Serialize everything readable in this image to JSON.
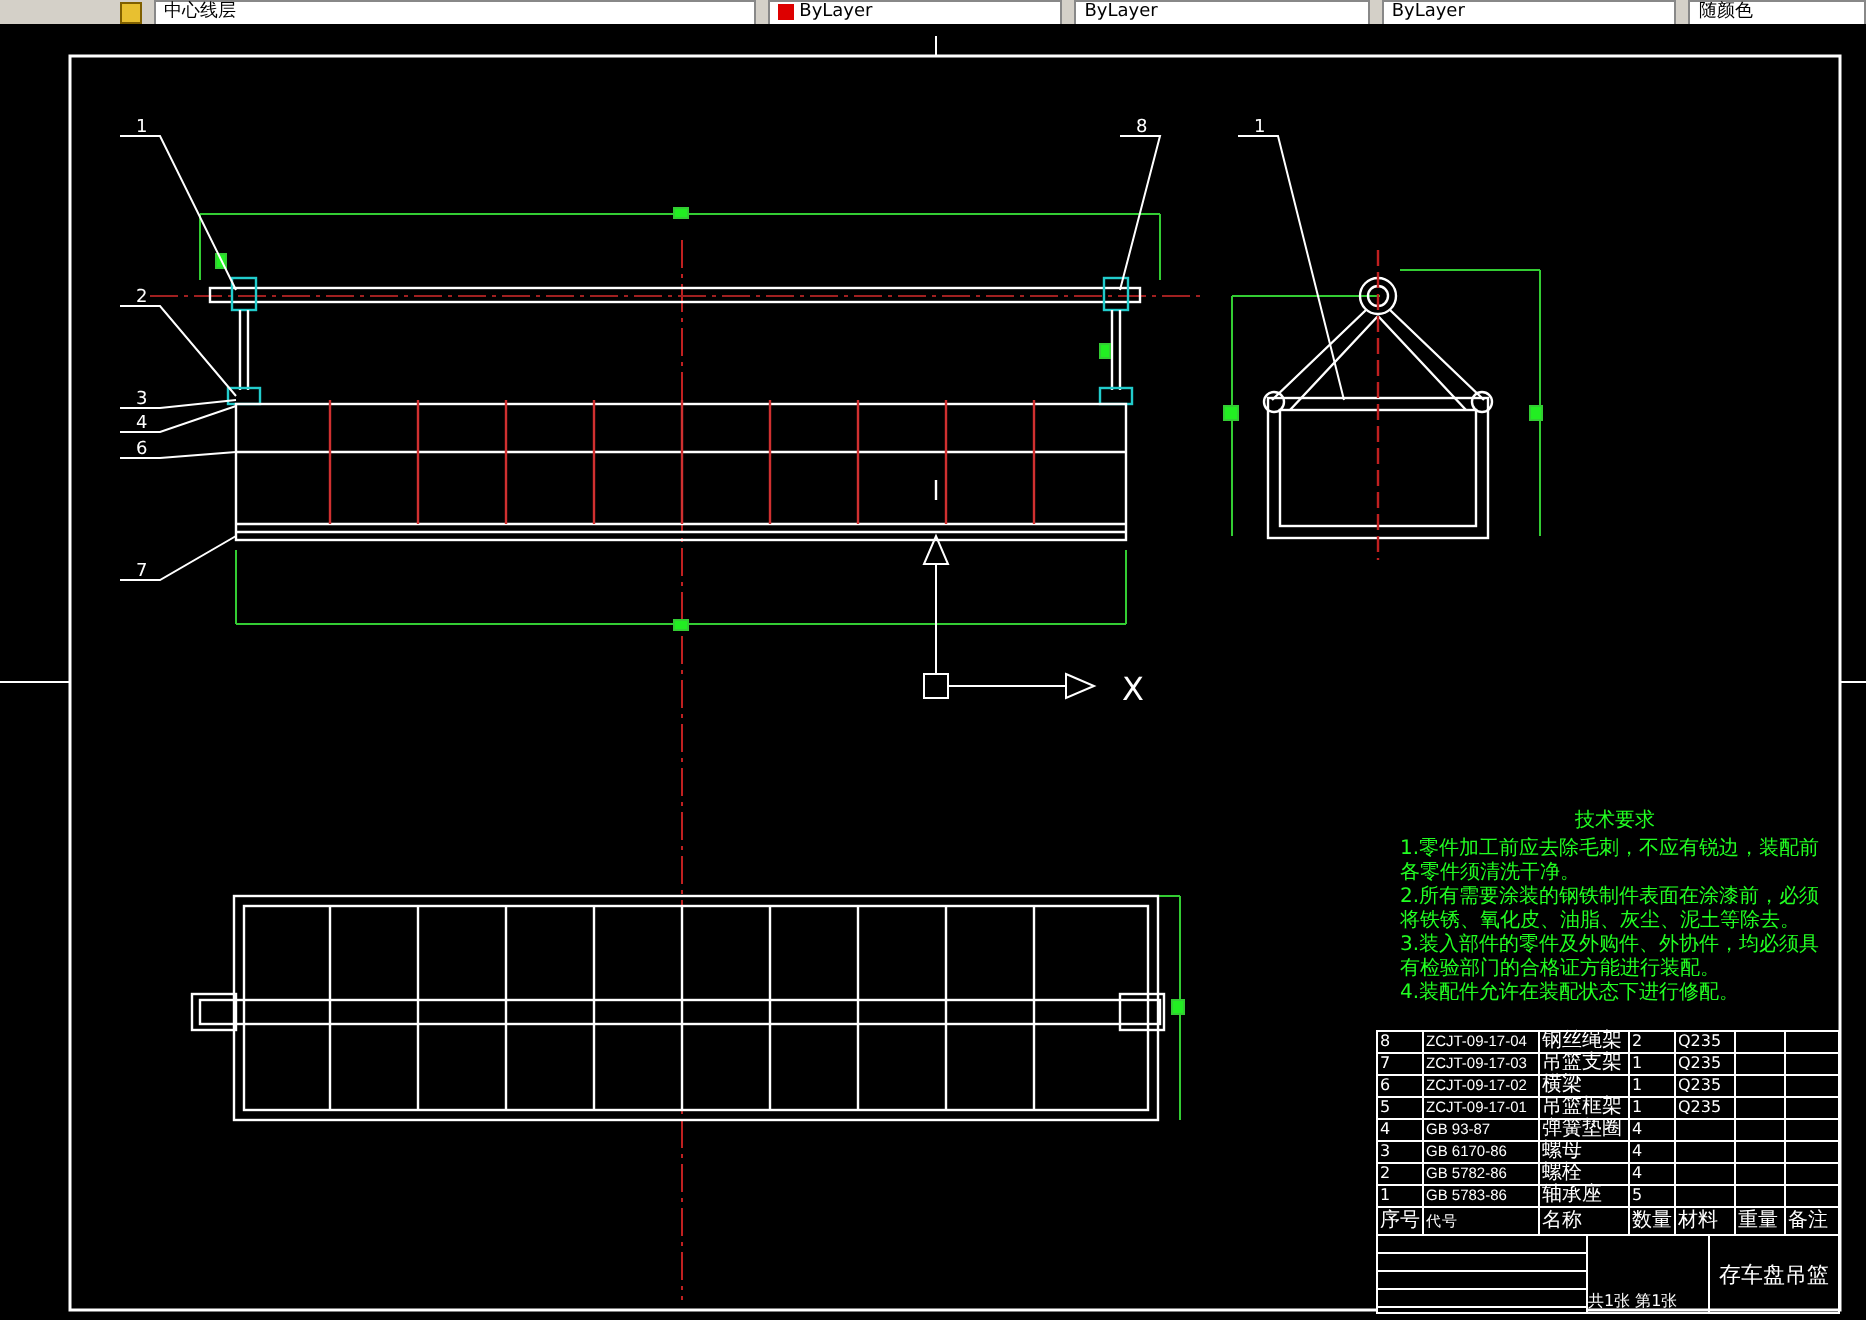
{
  "toolbar": {
    "layer": "中心线层",
    "properties": [
      {
        "kind": "color",
        "label": "ByLayer"
      },
      {
        "kind": "linetype",
        "label": "ByLayer"
      },
      {
        "kind": "lineweight",
        "label": "ByLayer"
      },
      {
        "kind": "plotstyle",
        "label": "随颜色"
      }
    ]
  },
  "drawing": {
    "part_labels": [
      "1",
      "2",
      "3",
      "4",
      "6",
      "7",
      "8",
      "1"
    ],
    "axis_label": "X"
  },
  "notes": {
    "title": "技术要求",
    "lines": [
      "1.零件加工前应去除毛刺，不应有锐边，装配前各零件须清洗干净。",
      "2.所有需要涂装的钢铁制件表面在涂漆前，必须将铁锈、氧化皮、油脂、灰尘、泥土等除去。",
      "3.装入部件的零件及外购件、外协件，均必须具有检验部门的合格证方能进行装配。",
      "4.装配件允许在装配状态下进行修配。"
    ]
  },
  "parts_list": {
    "columns": [
      "序号",
      "代号",
      "名称",
      "数量",
      "材料",
      "重量",
      "备注"
    ],
    "rows": [
      {
        "no": "8",
        "code": "ZCJT-09-17-04",
        "name": "钢丝绳架",
        "qty": "2",
        "material": "Q235"
      },
      {
        "no": "7",
        "code": "ZCJT-09-17-03",
        "name": "吊篮支架",
        "qty": "1",
        "material": "Q235"
      },
      {
        "no": "6",
        "code": "ZCJT-09-17-02",
        "name": "横梁",
        "qty": "1",
        "material": "Q235"
      },
      {
        "no": "5",
        "code": "ZCJT-09-17-01",
        "name": "吊篮框架",
        "qty": "1",
        "material": "Q235"
      },
      {
        "no": "4",
        "code": "GB 93-87",
        "name": "弹簧垫圈",
        "qty": "4",
        "material": ""
      },
      {
        "no": "3",
        "code": "GB 6170-86",
        "name": "螺母",
        "qty": "4",
        "material": ""
      },
      {
        "no": "2",
        "code": "GB 5782-86",
        "name": "螺栓",
        "qty": "4",
        "material": ""
      },
      {
        "no": "1",
        "code": "GB 5783-86",
        "name": "轴承座",
        "qty": "5",
        "material": ""
      }
    ]
  },
  "title_block": {
    "title": "存车盘吊篮",
    "sheet": "共1张 第1张"
  }
}
